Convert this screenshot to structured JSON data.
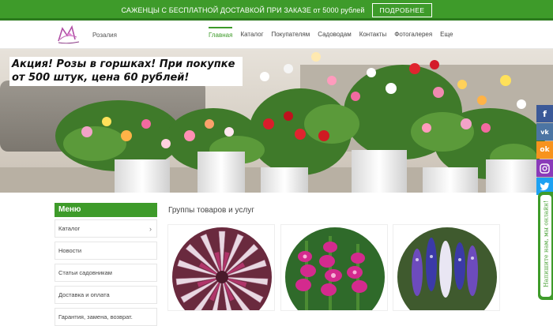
{
  "topbar": {
    "promo_text": "САЖЕНЦЫ С БЕСПЛАТНОЙ ДОСТАВКОЙ ПРИ ЗАКАЗЕ от 5000 рублей",
    "more_label": "ПОДРОБНЕЕ"
  },
  "header": {
    "brand": "Розалия",
    "nav": [
      "Главная",
      "Каталог",
      "Покупателям",
      "Садоводам",
      "Контакты",
      "Фотогалерея",
      "Еще"
    ],
    "active_nav": "Главная"
  },
  "hero": {
    "caption": "Акция! Розы в горшках! При покупке от 500 штук, цена 60 рублей!"
  },
  "social": {
    "items": [
      {
        "icon": "facebook-icon",
        "glyph": "f",
        "color": "#3b5998"
      },
      {
        "icon": "vk-icon",
        "glyph": "vk",
        "color": "#4c75a3"
      },
      {
        "icon": "odnoklassniki-icon",
        "glyph": "ok",
        "color": "#f7931e"
      },
      {
        "icon": "instagram-icon",
        "glyph": "◎",
        "color": "#8a3ab9"
      },
      {
        "icon": "twitter-icon",
        "glyph": "t",
        "color": "#1da1f2"
      }
    ]
  },
  "sidebar": {
    "title": "Меню",
    "items": [
      "Каталог",
      "Новости",
      "Статьи садовникам",
      "Доставка и оплата",
      "Гарантия, замена, возврат."
    ]
  },
  "main": {
    "section_title": "Группы товаров и услуг"
  },
  "chat": {
    "label": "Напишите нам, мы онлайн!"
  },
  "colors": {
    "accent": "#3e9b2a"
  }
}
